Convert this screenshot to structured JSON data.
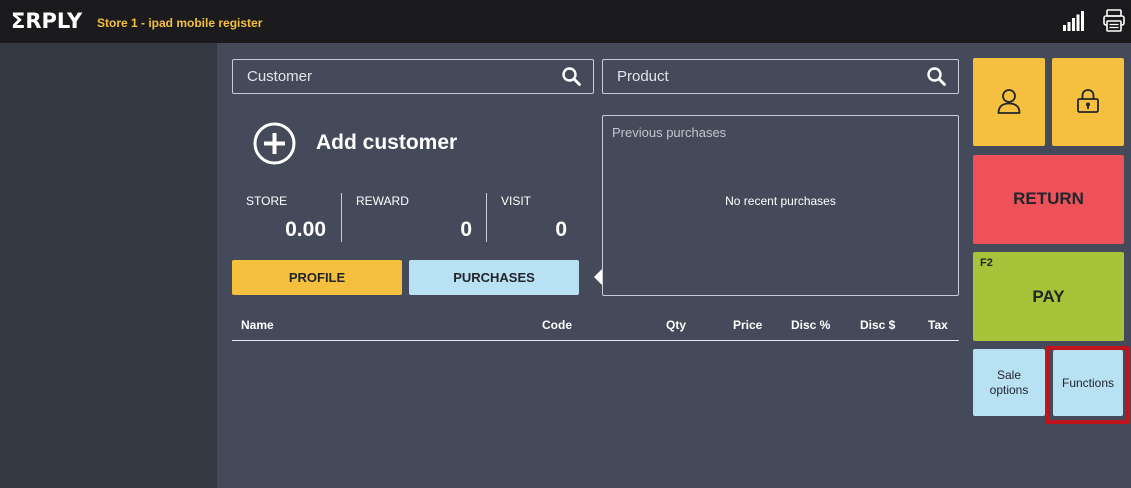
{
  "header": {
    "logo": "ΣRPLY",
    "store_name": "Store 1 - ipad mobile register",
    "icons": [
      "signal-icon",
      "printer-icon"
    ]
  },
  "search": {
    "customer_placeholder": "Customer",
    "product_placeholder": "Product"
  },
  "customer": {
    "add_label": "Add customer",
    "stats": [
      {
        "label": "STORE",
        "value": "0.00"
      },
      {
        "label": "REWARD",
        "value": "0"
      },
      {
        "label": "VISIT",
        "value": "0"
      }
    ],
    "tabs": {
      "profile": "PROFILE",
      "purchases": "PURCHASES"
    }
  },
  "previous_purchases": {
    "title": "Previous purchases",
    "empty_text": "No recent purchases"
  },
  "table": {
    "columns": [
      "Name",
      "Code",
      "Qty",
      "Price",
      "Disc %",
      "Disc $",
      "Tax"
    ],
    "rows": []
  },
  "actions": {
    "return_label": "RETURN",
    "pay_shortcut": "F2",
    "pay_label": "PAY",
    "sale_options_label": "Sale options",
    "functions_label": "Functions"
  },
  "colors": {
    "background": "#454a5a",
    "sidebar": "#353944",
    "topbar": "#1b1b1d",
    "accent_yellow": "#f5c03e",
    "return_red": "#ef5159",
    "pay_green": "#a6c439",
    "light_blue": "#b8e1f4",
    "highlight_frame": "#c0131b"
  }
}
